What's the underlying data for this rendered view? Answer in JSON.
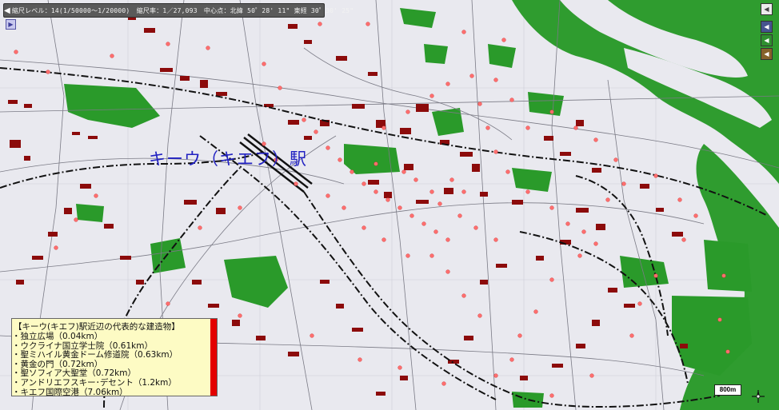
{
  "statusbar": {
    "text": "縮尺レベル：14(1/50000～1/20000)　縮尺率：1／27,093　中心点：北緯 50゜28' 11\" 東経 30゜30' 25\""
  },
  "map": {
    "station_label": "キーウ（キエフ）駅",
    "scale_label": "800m",
    "colors": {
      "background": "#e9e9ef",
      "park": "#2a9a2a",
      "river": "#2f9c2f",
      "building": "#8c0b0b",
      "poi": "#ff6e6e",
      "railway": "#111111"
    }
  },
  "legend": {
    "title": "【キーウ(キエフ)駅近辺の代表的な建造物】",
    "items": [
      "独立広場（0.04km）",
      "ウクライナ国立学士院（0.61km）",
      "聖ミハイル黄金ドーム修道院（0.63km）",
      "黄金の門（0.72km）",
      "聖ソフィア大聖堂（0.72km）",
      "アンドリエフスキー･デセント（1.2km）",
      "キエフ国際空港（7.06km）"
    ]
  },
  "controls": {
    "collapse_icon": "arrow-right-icon",
    "prev_icon": "arrow-left-icon",
    "back_icon": "arrow-left-icon",
    "play_icon": "arrow-left-icon",
    "layer_icon": "arrow-left-icon"
  }
}
